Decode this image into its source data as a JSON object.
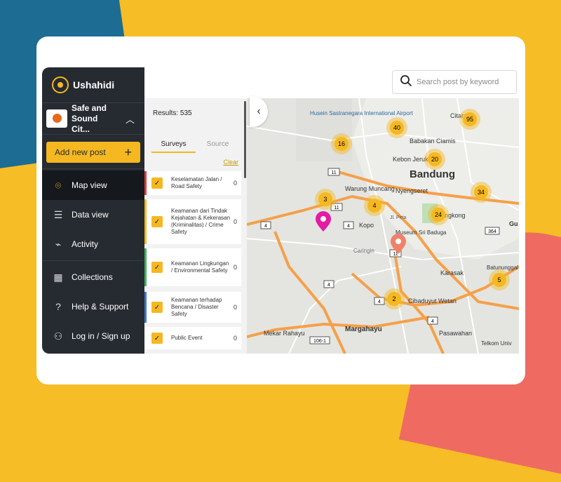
{
  "brand": {
    "name": "Ushahidi"
  },
  "deployment": {
    "name": "Safe and Sound Cit..."
  },
  "actions": {
    "add_post": "Add new post",
    "add_icon": "+"
  },
  "nav": [
    {
      "label": "Map view",
      "icon": "map-pin-icon",
      "glyph": "⌾"
    },
    {
      "label": "Data view",
      "icon": "data-list-icon",
      "glyph": "☰"
    },
    {
      "label": "Activity",
      "icon": "activity-chart-icon",
      "glyph": "⌁"
    },
    {
      "label": "Collections",
      "icon": "collections-grid-icon",
      "glyph": "▦"
    },
    {
      "label": "Help & Support",
      "icon": "help-icon",
      "glyph": "?"
    },
    {
      "label": "Log in / Sign up",
      "icon": "user-add-icon",
      "glyph": "⚇"
    }
  ],
  "search": {
    "placeholder": "Search post by keyword"
  },
  "filters": {
    "results": "Results: 535",
    "tabs": [
      "Surveys",
      "Source"
    ],
    "clear": "Clear",
    "surveys": [
      {
        "label": "Keselamatan Jalan / Road Safety",
        "count": "0",
        "color": "#e13c3c"
      },
      {
        "label": "Keamanan dari Tindak Kejahatan & Kekerasan (Kriminalitas) / Crime Safety",
        "count": "0",
        "color": "#f5b820"
      },
      {
        "label": "Keamanan Lingkungan / Environmental Safety",
        "count": "0",
        "color": "#3db55b"
      },
      {
        "label": "Keamanan terhadap Bencana / Disaster Safety",
        "count": "0",
        "color": "#3f79c9"
      },
      {
        "label": "Public Event",
        "count": "0",
        "color": "#ffffff"
      }
    ]
  },
  "map": {
    "places": [
      "Husein Sastranegara International Airport",
      "Citarum",
      "Babakan Ciamis",
      "Kebon Jeruk",
      "Bandung",
      "Warung Muncang",
      "Nyengseret",
      "Kopo",
      "Museum Sri Baduga",
      "Caringin",
      "Karasak",
      "Cibaduyut Wetan",
      "Margahayu",
      "Mekar Rahayu",
      "Pasawahan",
      "Telkom Univ",
      "Batununggal",
      "Jl. Peta",
      "Lengkong",
      "Gu"
    ],
    "clusters": [
      "95",
      "40",
      "16",
      "20",
      "34",
      "3",
      "4",
      "24",
      "5",
      "2"
    ],
    "road_numbers": [
      "11",
      "11",
      "4",
      "4",
      "364",
      "11",
      "4",
      "4",
      "4",
      "106-1"
    ],
    "colors": {
      "cluster": "#f5b820",
      "post_pin": "#e31ca3",
      "location_pin": "#f0826a",
      "major_road": "#f5a04a"
    }
  }
}
